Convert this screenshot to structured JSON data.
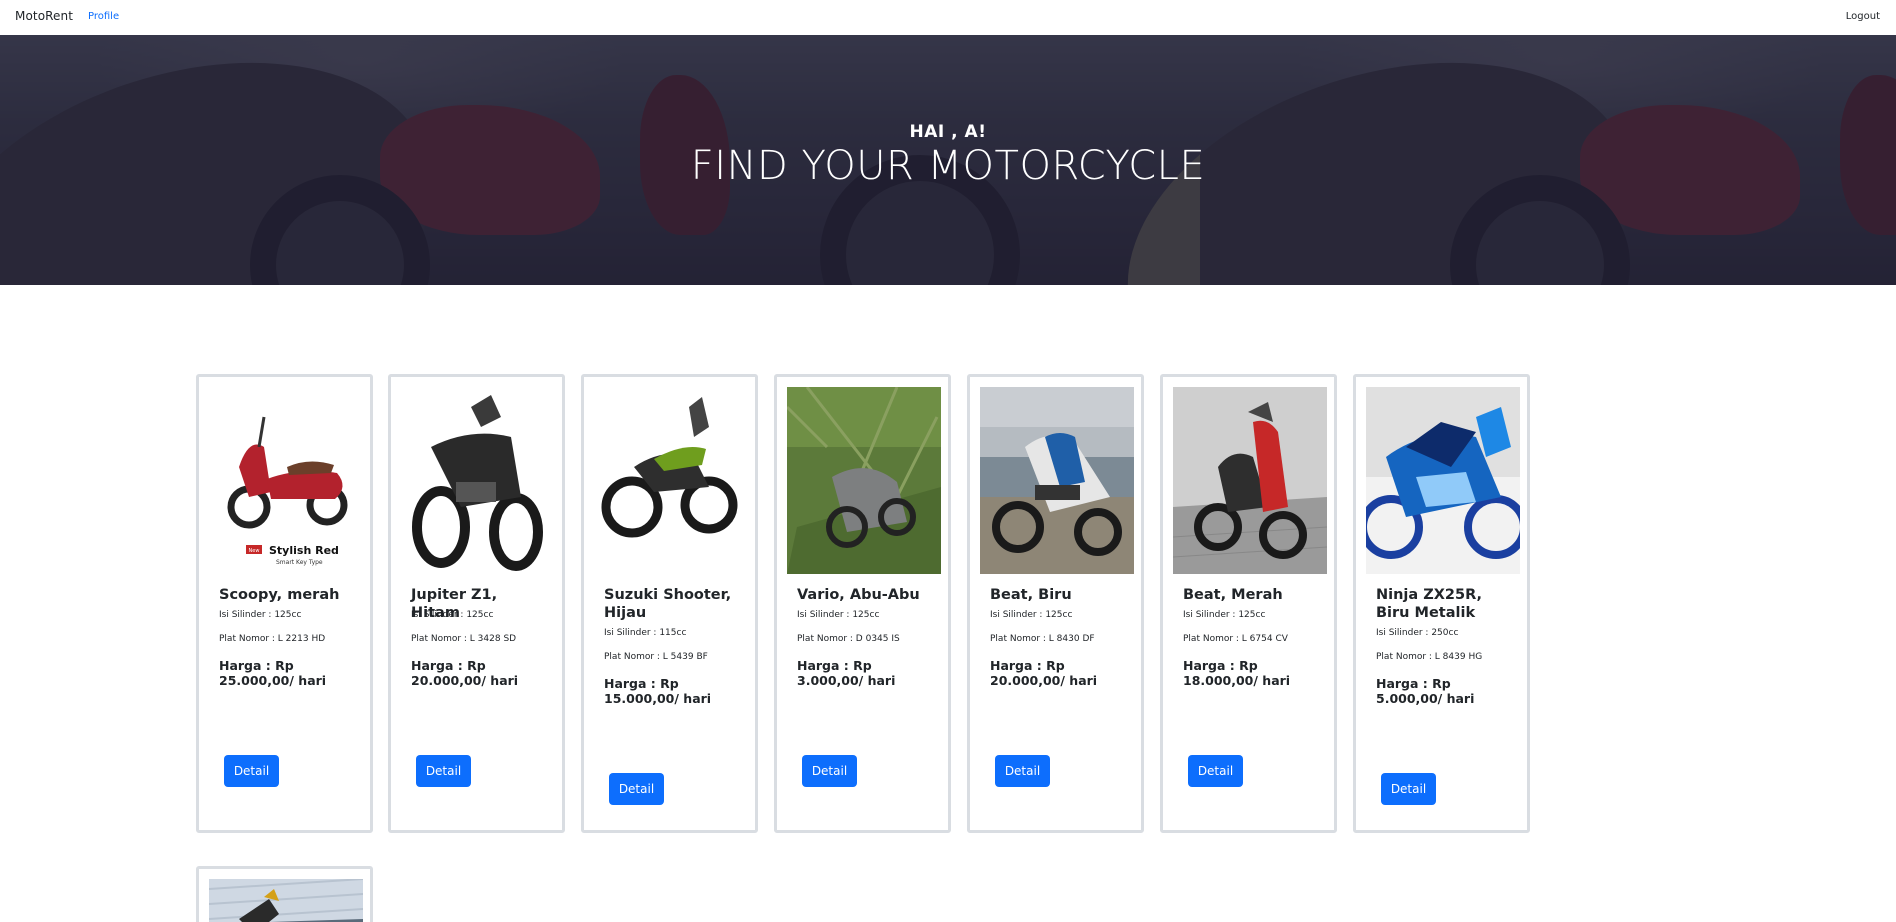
{
  "navbar": {
    "brand": "MotoRent",
    "profile_label": "Profile",
    "logout_label": "Logout"
  },
  "hero": {
    "greeting": "HAI , A!",
    "title": "FIND YOUR MOTORCYCLE"
  },
  "motorcycles": [
    {
      "name": "Scoopy, merah",
      "cylinder": "Isi Silinder : 125cc",
      "plate": "Plat Nomor : L 2213 HD",
      "price": "Harga : Rp 25.000,00/ hari",
      "button": "Detail",
      "image_caption": "Stylish Red",
      "image_subcaption": "Smart Key Type",
      "image_tag": "New",
      "color": "#b3222d"
    },
    {
      "name": "Jupiter Z1, Hitam",
      "cylinder": "Isi Silinder : 125cc",
      "plate": "Plat Nomor : L 3428 SD",
      "price": "Harga : Rp 20.000,00/ hari",
      "button": "Detail",
      "color": "#2a2a2a"
    },
    {
      "name": "Suzuki Shooter, Hijau",
      "cylinder": "Isi Silinder : 115cc",
      "plate": "Plat Nomor : L 5439 BF",
      "price": "Harga : Rp 15.000,00/ hari",
      "button": "Detail",
      "color": "#6f9e1e"
    },
    {
      "name": "Vario, Abu-Abu",
      "cylinder": "Isi Silinder : 125cc",
      "plate": "Plat Nomor : D 0345 IS",
      "price": "Harga : Rp 3.000,00/ hari",
      "button": "Detail",
      "color": "#7d7f80"
    },
    {
      "name": "Beat, Biru",
      "cylinder": "Isi Silinder : 125cc",
      "plate": "Plat Nomor : L 8430 DF",
      "price": "Harga : Rp 20.000,00/ hari",
      "button": "Detail",
      "color": "#1f5fa8"
    },
    {
      "name": "Beat, Merah",
      "cylinder": "Isi Silinder : 125cc",
      "plate": "Plat Nomor : L 6754 CV",
      "price": "Harga : Rp 18.000,00/ hari",
      "button": "Detail",
      "color": "#c62828"
    },
    {
      "name": "Ninja ZX25R, Biru Metalik",
      "cylinder": "Isi Silinder : 250cc",
      "plate": "Plat Nomor : L 8439 HG",
      "price": "Harga : Rp 5.000,00/ hari",
      "button": "Detail",
      "color": "#1565c0"
    }
  ],
  "colors": {
    "primary": "#0d6efd",
    "card_border": "#d9dde2",
    "hero_overlay": "#212034"
  }
}
